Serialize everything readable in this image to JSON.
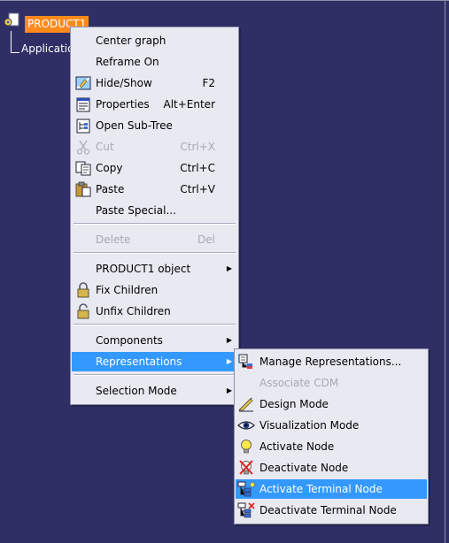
{
  "tree": {
    "root_label": "PRODUCT1",
    "child_label": "Applications"
  },
  "context_menu": {
    "items": [
      {
        "label": "Center graph",
        "shortcut": "",
        "icon": "none",
        "enabled": true,
        "submenu": false
      },
      {
        "label": "Reframe On",
        "shortcut": "",
        "icon": "none",
        "enabled": true,
        "submenu": false
      },
      {
        "label": "Hide/Show",
        "shortcut": "F2",
        "icon": "hide-show-icon",
        "enabled": true,
        "submenu": false
      },
      {
        "label": "Properties",
        "shortcut": "Alt+Enter",
        "icon": "properties-icon",
        "enabled": true,
        "submenu": false
      },
      {
        "label": "Open Sub-Tree",
        "shortcut": "",
        "icon": "sub-tree-icon",
        "enabled": true,
        "submenu": false
      },
      {
        "label": "Cut",
        "shortcut": "Ctrl+X",
        "icon": "scissors-icon",
        "enabled": false,
        "submenu": false
      },
      {
        "label": "Copy",
        "shortcut": "Ctrl+C",
        "icon": "copy-icon",
        "enabled": true,
        "submenu": false
      },
      {
        "label": "Paste",
        "shortcut": "Ctrl+V",
        "icon": "paste-icon",
        "enabled": true,
        "submenu": false
      },
      {
        "label": "Paste Special...",
        "shortcut": "",
        "icon": "none",
        "enabled": true,
        "submenu": false
      },
      {
        "label": "Delete",
        "shortcut": "Del",
        "icon": "none",
        "enabled": false,
        "submenu": false
      },
      {
        "label": "PRODUCT1 object",
        "shortcut": "",
        "icon": "none",
        "enabled": true,
        "submenu": true
      },
      {
        "label": "Fix Children",
        "shortcut": "",
        "icon": "lock-icon",
        "enabled": true,
        "submenu": false
      },
      {
        "label": "Unfix Children",
        "shortcut": "",
        "icon": "unlock-icon",
        "enabled": true,
        "submenu": false
      },
      {
        "label": "Components",
        "shortcut": "",
        "icon": "none",
        "enabled": true,
        "submenu": true
      },
      {
        "label": "Representations",
        "shortcut": "",
        "icon": "none",
        "enabled": true,
        "submenu": true,
        "highlighted": true
      },
      {
        "label": "Selection Mode",
        "shortcut": "",
        "icon": "none",
        "enabled": true,
        "submenu": true
      }
    ]
  },
  "representations_submenu": {
    "items": [
      {
        "label": "Manage Representations...",
        "icon": "manage-representations-icon",
        "enabled": true
      },
      {
        "label": "Associate CDM",
        "icon": "none",
        "enabled": false
      },
      {
        "label": "Design Mode",
        "icon": "design-mode-icon",
        "enabled": true
      },
      {
        "label": "Visualization Mode",
        "icon": "eye-icon",
        "enabled": true
      },
      {
        "label": "Activate Node",
        "icon": "lightbulb-icon",
        "enabled": true
      },
      {
        "label": "Deactivate Node",
        "icon": "deactivate-node-icon",
        "enabled": true
      },
      {
        "label": "Activate Terminal Node",
        "icon": "activate-terminal-node-icon",
        "enabled": true,
        "highlighted": true
      },
      {
        "label": "Deactivate Terminal Node",
        "icon": "deactivate-terminal-node-icon",
        "enabled": true
      }
    ]
  },
  "colors": {
    "background": "#2f2f66",
    "menu_background": "#e9e9f2",
    "highlight": "#3399ff",
    "tree_selection": "#ff8a1a"
  }
}
